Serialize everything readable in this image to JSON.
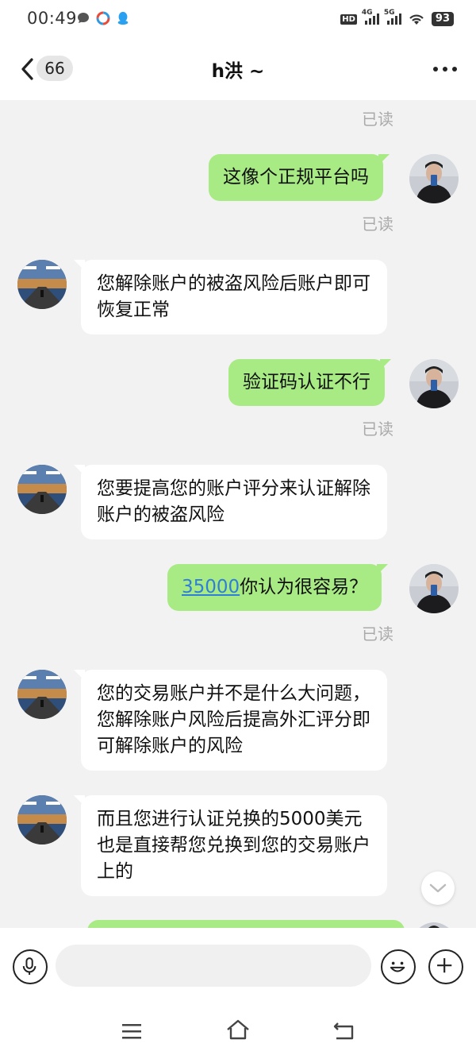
{
  "status_bar": {
    "time": "00:49",
    "hd_label": "HD",
    "signal_labels": [
      "4G",
      "5G"
    ],
    "battery": "93"
  },
  "header": {
    "unread_count": "66",
    "title": "h洪 ~"
  },
  "messages": [
    {
      "direction": "out",
      "read_status": "已读",
      "read_only": true
    },
    {
      "direction": "out",
      "text": "这像个正规平台吗",
      "read_status": "已读"
    },
    {
      "direction": "in",
      "text": "您解除账户的被盗风险后账户即可恢复正常"
    },
    {
      "direction": "out",
      "text": "验证码认证不行",
      "read_status": "已读"
    },
    {
      "direction": "in",
      "text": "您要提高您的账户评分来认证解除账户的被盗风险"
    },
    {
      "direction": "out",
      "link_text": "35000",
      "text": "你认为很容易？",
      "read_status": "已读"
    },
    {
      "direction": "in",
      "text": "您的交易账户并不是什么大问题，您解除账户风险后提高外汇评分即可解除账户的风险"
    },
    {
      "direction": "in",
      "text": "而且您进行认证兑换的5000美元也是直接帮您兑换到您的交易账户上的"
    }
  ],
  "colors": {
    "outgoing_bubble": "#a8ea84",
    "incoming_bubble": "#ffffff",
    "chat_background": "#f2f2f2",
    "link": "#2f7fd8",
    "read_tag": "#aaaaaa"
  },
  "icons": {
    "back": "chevron-left-icon",
    "more": "more-dots-icon",
    "voice": "mic-icon",
    "emoji": "smile-icon",
    "plus": "plus-icon",
    "scroll_down": "chevron-down-icon",
    "nav_menu": "menu-icon",
    "nav_home": "home-icon",
    "nav_back": "back-icon"
  }
}
